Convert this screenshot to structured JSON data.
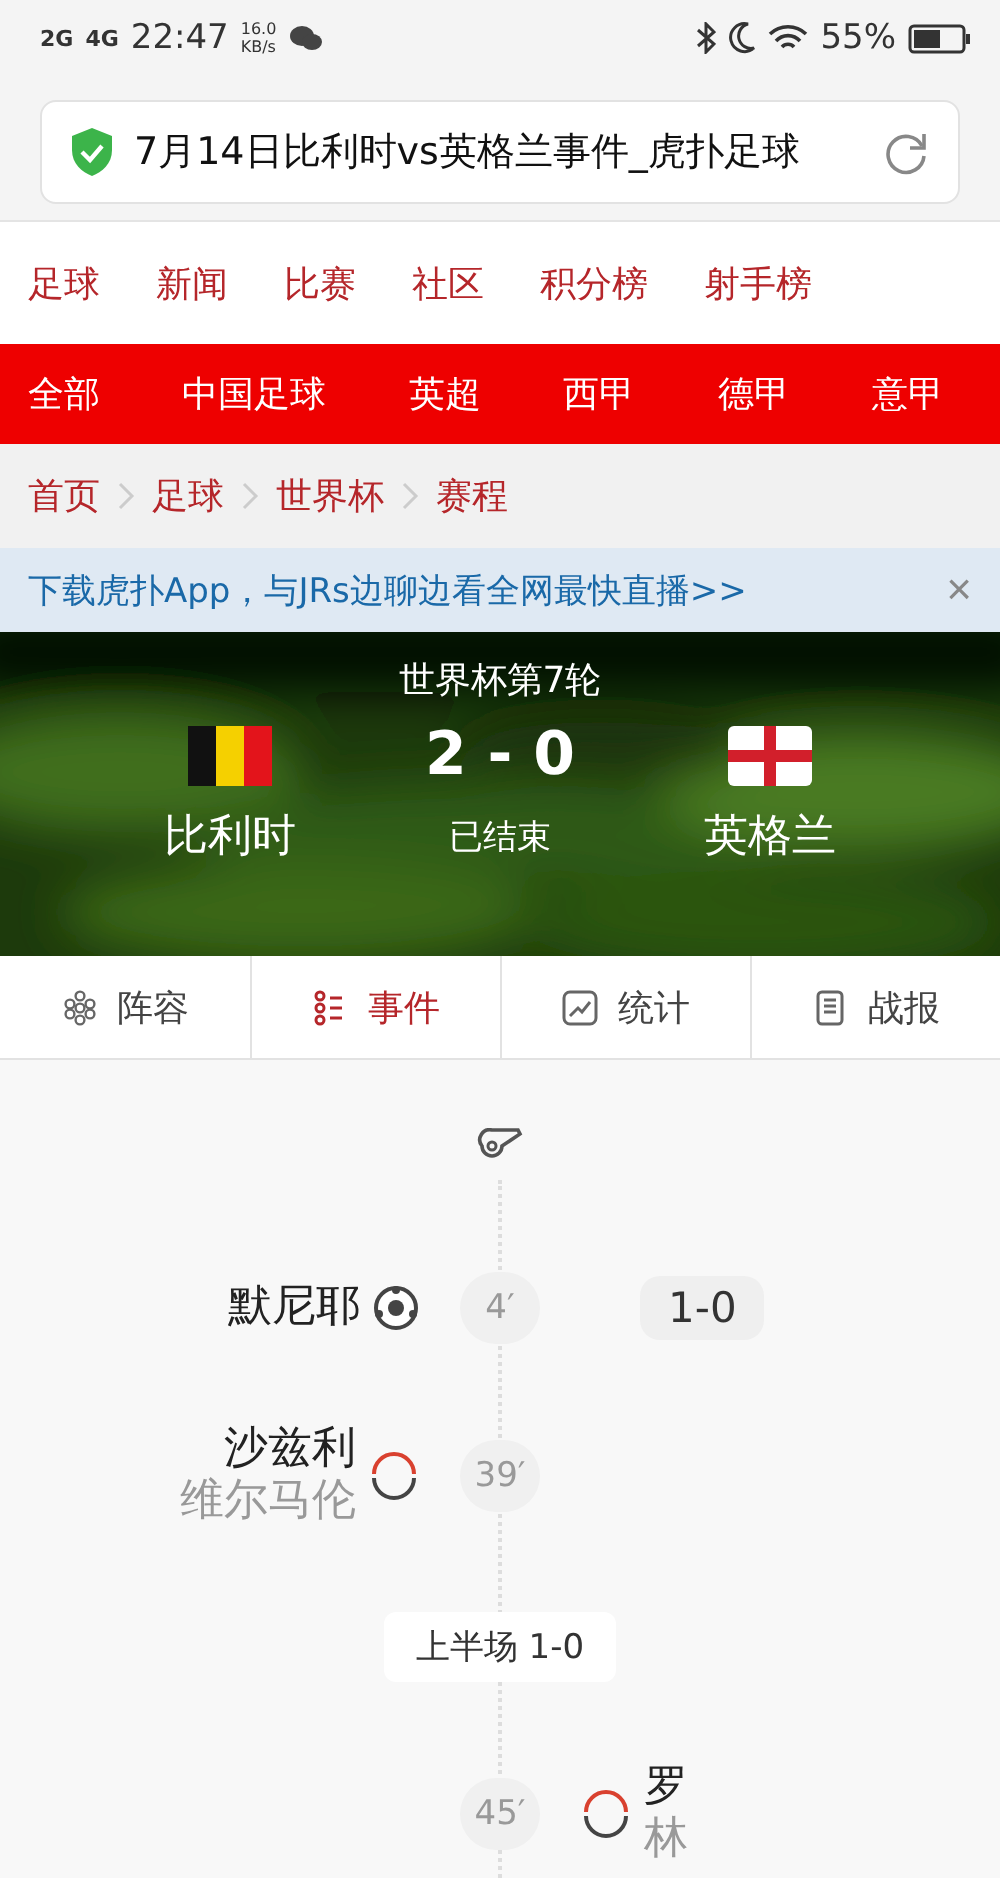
{
  "status_bar": {
    "networks": [
      "2G",
      "4G"
    ],
    "time": "22:47",
    "speed_value": "16.0",
    "speed_unit": "KB/s",
    "battery": "55%"
  },
  "address_bar": {
    "title": "7月14日比利时vs英格兰事件_虎扑足球"
  },
  "main_nav": [
    "足球",
    "新闻",
    "比赛",
    "社区",
    "积分榜",
    "射手榜"
  ],
  "league_nav": [
    "全部",
    "中国足球",
    "英超",
    "西甲",
    "德甲",
    "意甲"
  ],
  "breadcrumb": [
    "首页",
    "足球",
    "世界杯",
    "赛程"
  ],
  "banner": {
    "text": "下载虎扑App，与JRs边聊边看全网最快直播>>",
    "close": "×"
  },
  "match": {
    "round": "世界杯第7轮",
    "score": "2 - 0",
    "status": "已结束",
    "home": {
      "name": "比利时"
    },
    "away": {
      "name": "英格兰"
    }
  },
  "tabs": [
    {
      "label": "阵容",
      "selected": false
    },
    {
      "label": "事件",
      "selected": true
    },
    {
      "label": "统计",
      "selected": false
    },
    {
      "label": "战报",
      "selected": false
    }
  ],
  "timeline": [
    {
      "kind": "home-goal",
      "minute": "4′",
      "player": "默尼耶",
      "score": "1-0"
    },
    {
      "kind": "home-sub",
      "minute": "39′",
      "player": "沙兹利",
      "player_out": "维尔马伦"
    },
    {
      "kind": "period",
      "label": "上半场 1-0"
    },
    {
      "kind": "away-sub",
      "minute": "45′",
      "player": "罗",
      "player_out": "林"
    }
  ]
}
